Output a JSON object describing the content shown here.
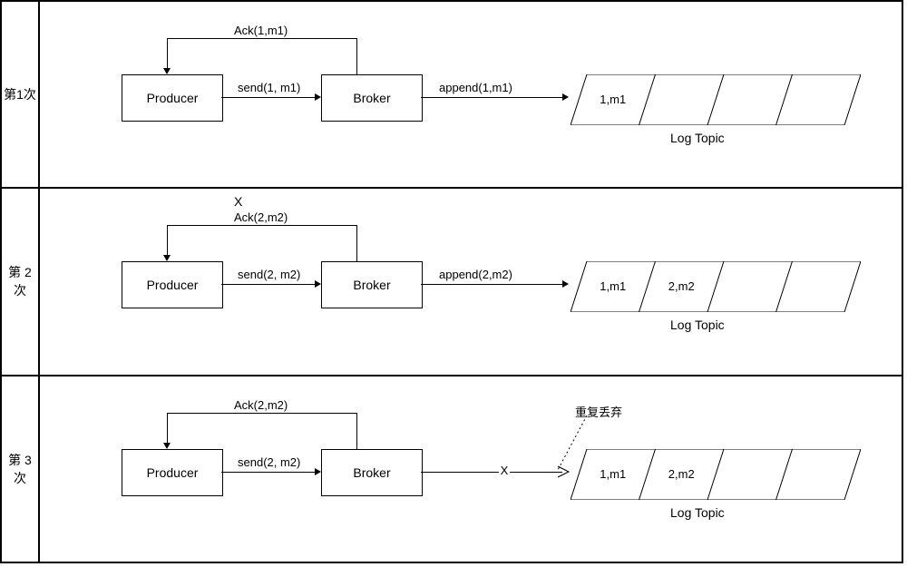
{
  "rows": [
    {
      "label": "第1次",
      "producer": "Producer",
      "broker": "Broker",
      "ack": "Ack(1,m1)",
      "send": "send(1, m1)",
      "append": "append(1,m1)",
      "ackFail": "",
      "discard": "",
      "log": {
        "cells": [
          "1,m1",
          "",
          "",
          ""
        ],
        "caption": "Log Topic"
      },
      "appendMode": "normal"
    },
    {
      "label": "第 2 次",
      "producer": "Producer",
      "broker": "Broker",
      "ack": "Ack(2,m2)",
      "send": "send(2, m2)",
      "append": "append(2,m2)",
      "ackFail": "X",
      "discard": "",
      "log": {
        "cells": [
          "1,m1",
          "2,m2",
          "",
          ""
        ],
        "caption": "Log Topic"
      },
      "appendMode": "normal"
    },
    {
      "label": "第 3 次",
      "producer": "Producer",
      "broker": "Broker",
      "ack": "Ack(2,m2)",
      "send": "send(2, m2)",
      "append": "X",
      "ackFail": "",
      "discard": "重复丢弃",
      "log": {
        "cells": [
          "1,m1",
          "2,m2",
          "",
          ""
        ],
        "caption": "Log Topic"
      },
      "appendMode": "discard"
    }
  ]
}
